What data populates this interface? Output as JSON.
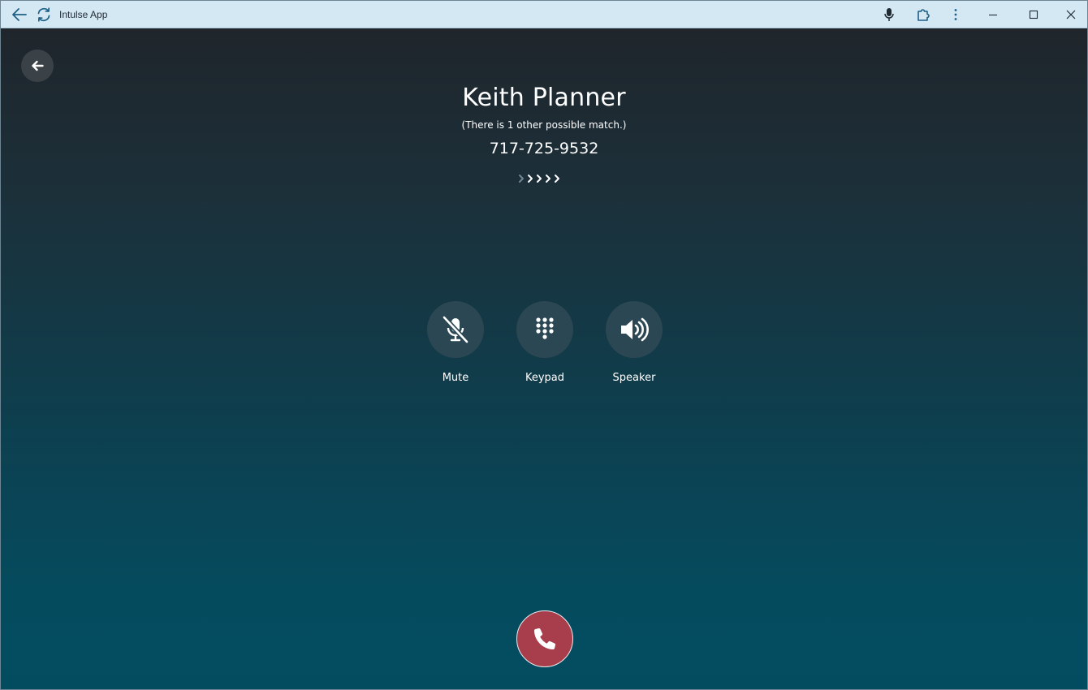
{
  "titlebar": {
    "app_title": "Intulse App",
    "icons": {
      "back": "arrow-left-icon",
      "reload": "refresh-icon",
      "mic": "microphone-icon",
      "extension": "puzzle-icon",
      "more": "more-vertical-icon",
      "minimize": "minimize-icon",
      "maximize": "maximize-icon",
      "close": "close-icon"
    },
    "accent_color": "#1d5f86"
  },
  "call": {
    "caller_name": "Keith Planner",
    "match_note": "(There is 1 other possible match.)",
    "phone_number": "717-725-9532",
    "progress": {
      "total_steps": 5,
      "dim_steps": 1
    },
    "controls": [
      {
        "id": "mute",
        "label": "Mute",
        "icon": "microphone-slash-icon"
      },
      {
        "id": "keypad",
        "label": "Keypad",
        "icon": "dialpad-icon"
      },
      {
        "id": "speaker",
        "label": "Speaker",
        "icon": "speaker-volume-icon"
      }
    ],
    "hangup": {
      "icon": "phone-icon",
      "color": "#a83d4c"
    },
    "back_icon": "arrow-left-icon"
  }
}
